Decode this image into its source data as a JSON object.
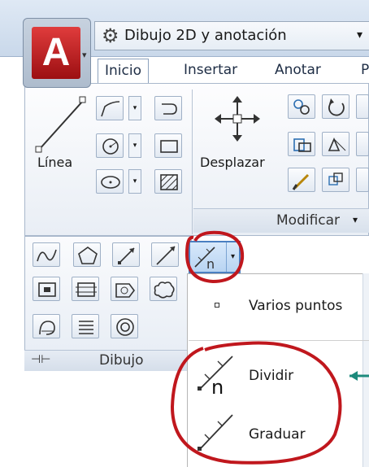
{
  "app": {
    "logo_letter": "A",
    "menu_arrow": "▾"
  },
  "workspace": {
    "label": "Dibujo 2D y anotación",
    "arrow": "▾"
  },
  "tabs": [
    {
      "label": "Inicio"
    },
    {
      "label": "Insertar"
    },
    {
      "label": "Anotar"
    },
    {
      "label": "P"
    }
  ],
  "draw_panel": {
    "line_label": "Línea",
    "title": "Dibujo"
  },
  "modify_panel": {
    "move_label": "Desplazar",
    "title": "Modificar",
    "title_arrow": "▾"
  },
  "point_dropdown": {
    "items": [
      {
        "label": "Varios puntos",
        "icon": "point-icon"
      },
      {
        "label": "Dividir",
        "icon": "divide-icon"
      },
      {
        "label": "Graduar",
        "icon": "measure-icon"
      }
    ]
  },
  "colors": {
    "annotation": "#c0171d",
    "accent": "#4a7fc1",
    "arrow_teal": "#1c8a7c"
  }
}
